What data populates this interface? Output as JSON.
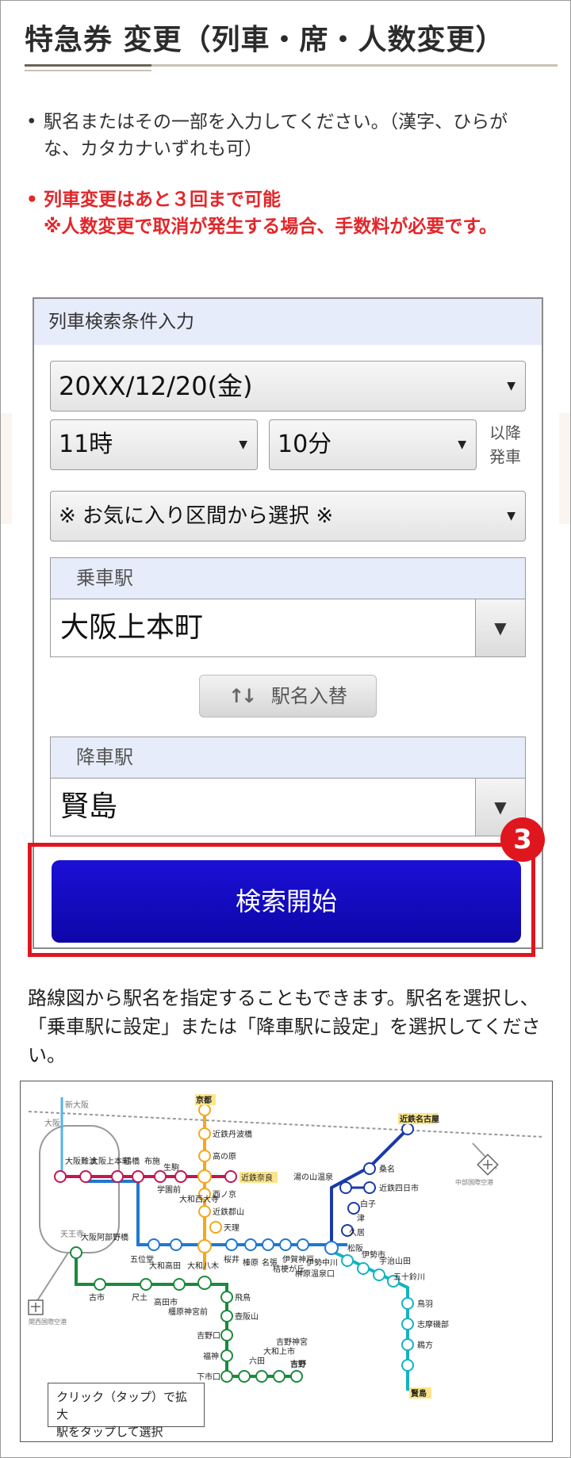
{
  "page": {
    "title": "特急券 変更（列車・席・人数変更）",
    "notice_text": "駅名またはその一部を入力してください。（漢字、ひらがな、カタカナいずれも可）",
    "warning_text_1": "列車変更はあと３回まで可能",
    "warning_text_2": "※人数変更で取消が発生する場合、手数料が必要です。"
  },
  "search_panel": {
    "header": "列車検索条件入力",
    "date": "20XX/12/20(金)",
    "hour": "11時",
    "minute": "10分",
    "after_label_1": "以降",
    "after_label_2": "発車",
    "favorite": "※ お気に入り区間から選択 ※",
    "boarding_label": "乗車駅",
    "boarding_value": "大阪上本町",
    "swap_label": "駅名入替",
    "alighting_label": "降車駅",
    "alighting_value": "賢島",
    "search_button": "検索開始",
    "step_number": "3"
  },
  "route_map_text": "路線図から駅名を指定することもできます。駅名を選択し、「乗車駅に設定」または「降車駅に設定」を選択してください。",
  "route_map": {
    "hint_line_1": "クリック（タップ）で拡大",
    "hint_line_2": "駅をタップして選択",
    "colors": {
      "orange": "#f2a81d",
      "blue": "#1f78d1",
      "red": "#c4174f",
      "green": "#1a8a3c",
      "navy": "#1a3aa6",
      "teal": "#16b2c1",
      "light_blue": "#52b3e8"
    },
    "labels": {
      "shin_osaka": "新大阪",
      "osaka": "大阪",
      "kyoto": "京都",
      "kintetsu_tambabashi": "近鉄丹波橋",
      "takanohara": "高の原",
      "kintetsu_nara": "近鉄奈良",
      "yamato_saidaiji": "大和西大寺",
      "gakuemmae": "学園前",
      "ikoma": "生駒",
      "fuse": "布施",
      "tsuruhashi": "鶴橋",
      "osaka_uehommachi": "大阪上本町",
      "osaka_namba": "大阪難波",
      "nishinokyo": "西ノ京",
      "kintetsu_koriyama": "近鉄郡山",
      "tenri": "天理",
      "goidou": "五位堂",
      "yamato_takada": "大和高田",
      "yamato_yagi": "大和八木",
      "sakurai": "桜井",
      "haibara": "榛原",
      "nabari": "名張",
      "iga_kambe": "伊賀神戸",
      "kiriyama": "桔梗が丘",
      "sakakibara_onsenguchi": "榊原温泉口",
      "ise_nakagawa": "伊勢中川",
      "kintetsu_nagoya": "近鉄名古屋",
      "kuwana": "桑名",
      "yunoyama_onsen": "湯の山温泉",
      "kintetsu_yokkaichi": "近鉄四日市",
      "shiroko": "白子",
      "tsu": "津",
      "hisai": "久居",
      "matsusaka": "松阪",
      "iseshi": "伊勢市",
      "ujiyamada": "宇治山田",
      "isuzugawa": "五十鈴川",
      "toba": "鳥羽",
      "shima_isobe": "志摩磯部",
      "ugata": "鵜方",
      "kashikojima": "賢島",
      "chubu_airport": "中部国際空港",
      "tennoji": "天王寺",
      "osaka_abenobashi": "大阪阿部野橋",
      "furuichi": "古市",
      "shakudo": "尺土",
      "takadashi": "高田市",
      "kashiharajingumae": "橿原神宮前",
      "asuka": "飛鳥",
      "tsubosakayama": "壺阪山",
      "yoshinoguchi": "吉野口",
      "fukugami": "福神",
      "shimoichiguchi": "下市口",
      "mutsuda": "六田",
      "yamato_kamiichi": "大和上市",
      "yoshino_jingu": "吉野神宮",
      "yoshino": "吉野",
      "kansai_airport": "関西国際空港"
    }
  }
}
